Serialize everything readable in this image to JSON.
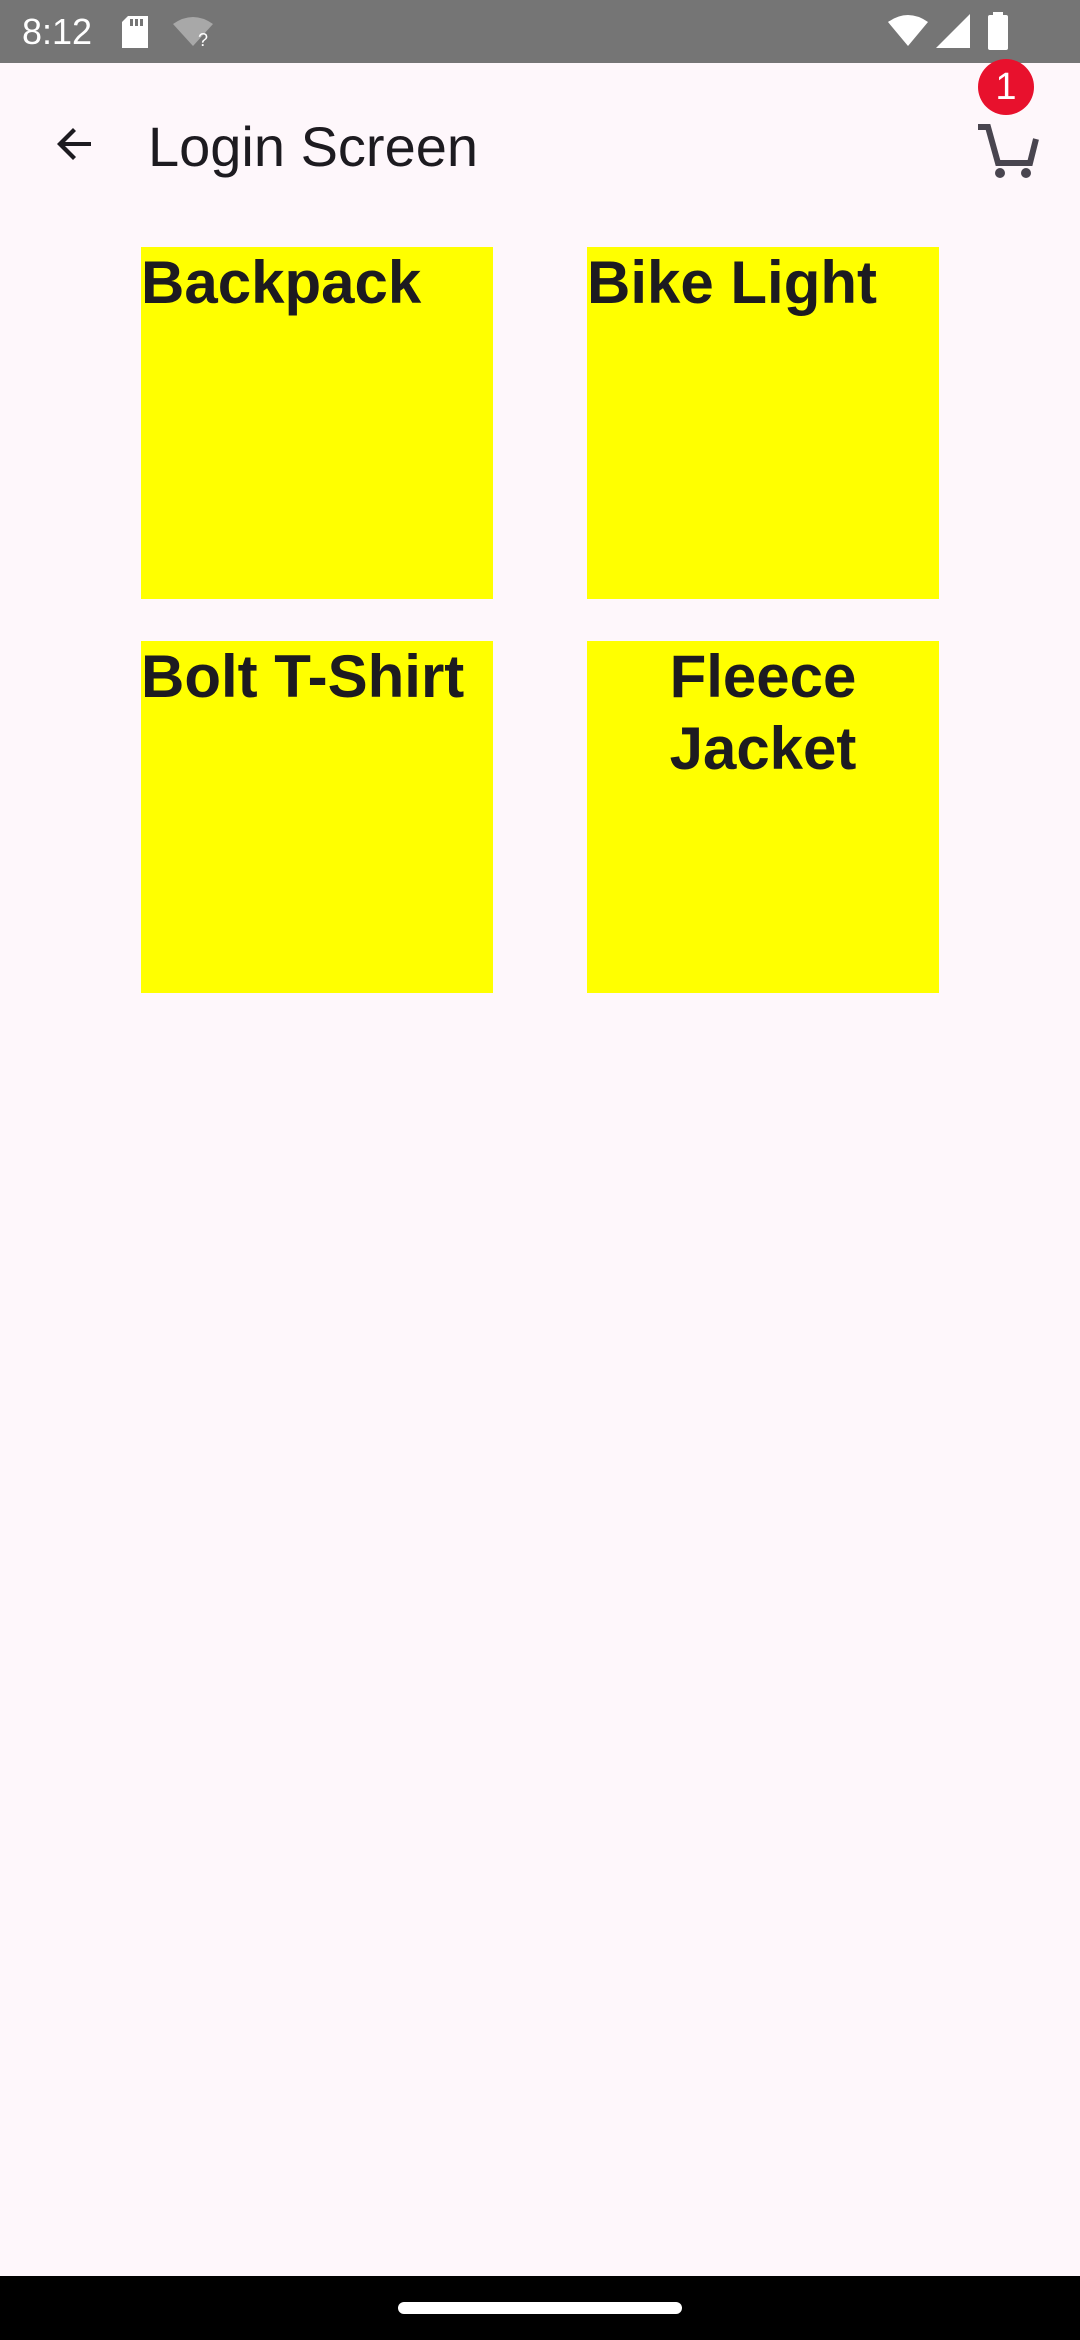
{
  "status_bar": {
    "time": "8:12",
    "icons": [
      "sd-card-icon",
      "wifi-unknown-icon",
      "wifi-signal-icon",
      "cellular-signal-icon",
      "battery-icon"
    ]
  },
  "app_bar": {
    "title": "Login Screen",
    "back_icon": "arrow-back-icon",
    "cart_icon": "shopping-cart-icon",
    "cart_badge_count": "1"
  },
  "products": [
    {
      "name": "Backpack"
    },
    {
      "name": "Bike Light"
    },
    {
      "name": "Bolt T-Shirt"
    },
    {
      "name": "Fleece Jacket"
    }
  ],
  "colors": {
    "background": "#fef7fb",
    "tile": "#ffff00",
    "badge": "#e8112d",
    "status_bar": "#757575",
    "text": "#1d1b20"
  }
}
